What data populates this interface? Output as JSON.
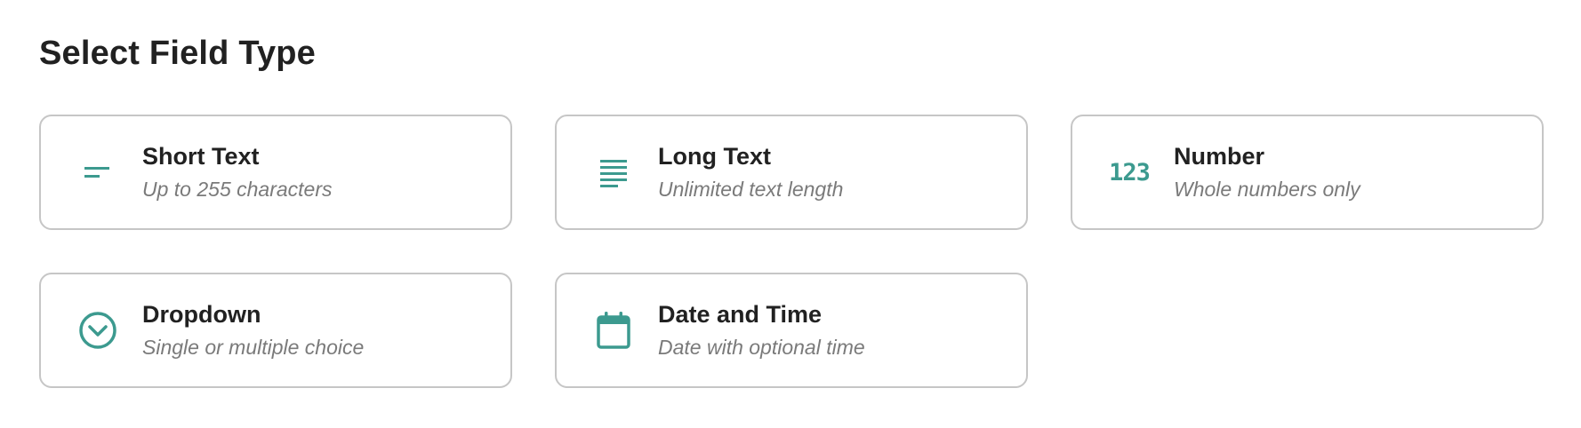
{
  "page": {
    "title": "Select Field Type"
  },
  "accent_color": "#3c9a8f",
  "field_types": [
    {
      "title": "Short Text",
      "subtitle": "Up to 255 characters",
      "icon": "short-text-icon"
    },
    {
      "title": "Long Text",
      "subtitle": "Unlimited text length",
      "icon": "long-text-icon"
    },
    {
      "title": "Number",
      "subtitle": "Whole numbers only",
      "icon": "number-icon",
      "icon_text": "123"
    },
    {
      "title": "Dropdown",
      "subtitle": "Single or multiple choice",
      "icon": "dropdown-circle-icon"
    },
    {
      "title": "Date and Time",
      "subtitle": "Date with optional time",
      "icon": "calendar-icon"
    }
  ]
}
